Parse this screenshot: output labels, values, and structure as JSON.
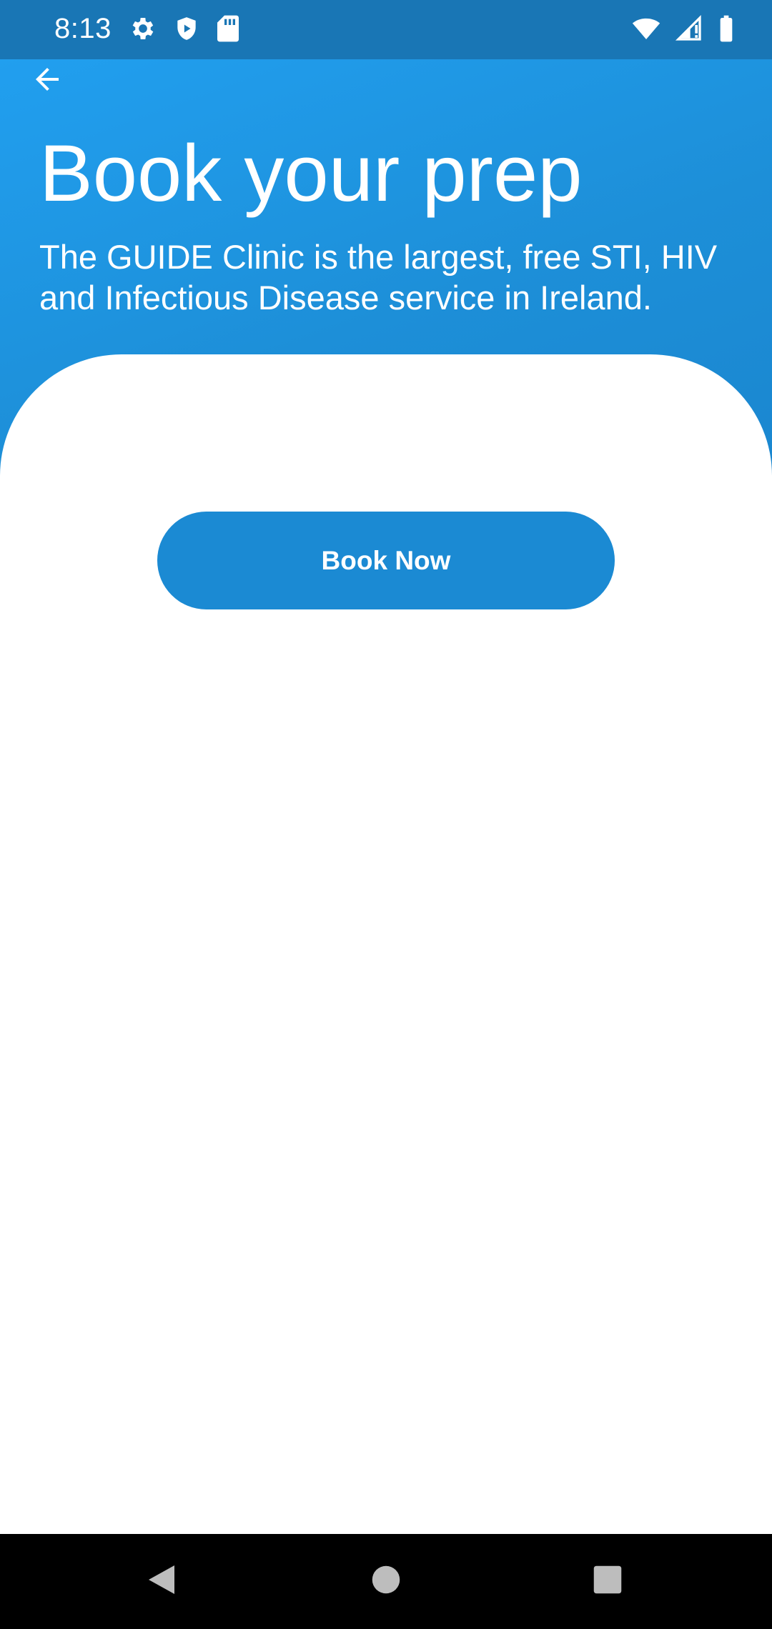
{
  "status_bar": {
    "time": "8:13",
    "left_icons": [
      "settings-icon",
      "play-protect-icon",
      "sd-card-icon"
    ],
    "right_icons": [
      "wifi-icon",
      "signal-icon",
      "battery-icon"
    ]
  },
  "header": {
    "back_icon": "arrow-back-icon",
    "title": "Book your prep",
    "subtitle": "The GUIDE Clinic is the largest, free STI, HIV and Infectious Disease service in Ireland."
  },
  "main": {
    "book_button_label": "Book Now"
  },
  "nav_bar": {
    "buttons": [
      "back-triangle-icon",
      "home-circle-icon",
      "recents-square-icon"
    ]
  },
  "colors": {
    "status_bar": "#1976b5",
    "header_gradient_start": "#219fef",
    "header_gradient_end": "#1a86cf",
    "button": "#1b8ad3",
    "text_on_blue": "#ffffff",
    "nav_bar": "#000000"
  }
}
